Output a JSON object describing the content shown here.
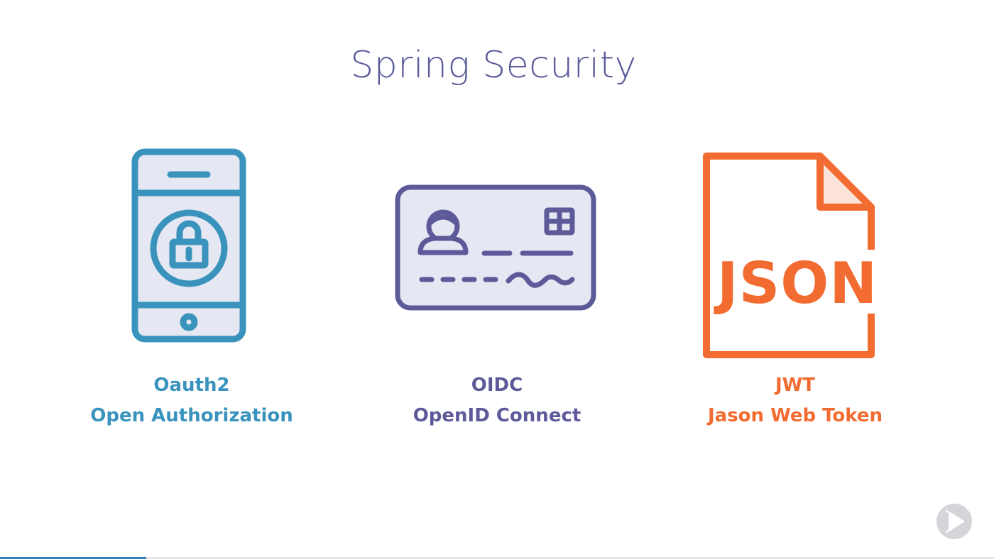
{
  "slide": {
    "title": "Spring Security",
    "items": [
      {
        "icon": "smartphone-lock-icon",
        "color": "#3a93bc",
        "fill": "#e5e7f2",
        "line1": "Oauth2",
        "line2": "Open Authorization"
      },
      {
        "icon": "id-card-icon",
        "color": "#5d5a99",
        "fill": "#e5e7f2",
        "line1": "OIDC",
        "line2": "OpenID Connect"
      },
      {
        "icon": "json-file-icon",
        "color": "#f26b30",
        "fill": "#fde3d8",
        "line1": "JWT",
        "line2": "Jason Web Token"
      }
    ]
  },
  "player": {
    "play_icon": "play-icon",
    "progress": 0.147
  },
  "colors": {
    "title": "#595a9a",
    "progress": "#2f7fc1"
  }
}
